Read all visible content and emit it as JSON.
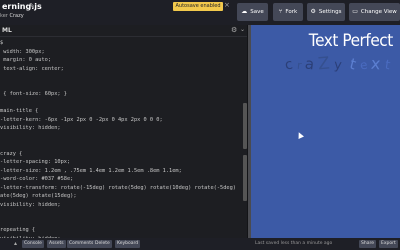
{
  "header": {
    "title": "erning.js",
    "author_prefix": "ker",
    "author_name": "Crazy",
    "autosave": "Autosave enabled",
    "save_label": "Save",
    "fork_label": "Fork",
    "settings_label": "Settings",
    "view_label": "Change View",
    "icons": [
      "pencil-icon",
      "close-icon",
      "cloud-icon",
      "fork-icon",
      "gear-icon",
      "layout-icon"
    ]
  },
  "editor": {
    "language": "ML",
    "lines": [
      "$",
      " width: 300px;",
      " margin: 0 auto;",
      " text-align: center;",
      "",
      "",
      " { font-size: 60px; }",
      "",
      "main-title {",
      "-letter-kern: -6px -1px 2px 0 -2px 0 4px 2px 0 0 0;",
      "visibility: hidden;",
      "",
      "",
      "crazy {",
      "-letter-spacing: 10px;",
      "-letter-size: 1.2em , .75em 1.4em 1.2em 1.5em .8em 1.1em;",
      "-word-color: #037 #58e;",
      "-letter-transform: rotate(-15deg) rotate(5deg) rotate(10deg) rotate(-5deg)",
      "ate(5deg) rotate(15deg);",
      "visibility: hidden;",
      "",
      "",
      "repeating {",
      "visibility: hidden;"
    ]
  },
  "preview": {
    "title": "Text Perfect",
    "crazy_letters": [
      "c",
      "r",
      "a",
      "Z",
      "y",
      " ",
      "t",
      "e",
      "x",
      "t"
    ]
  },
  "bottombar": {
    "console": "Console",
    "assets": "Assets",
    "comments": "Comments",
    "delete": "Delete",
    "keyboard": "Keyboard",
    "status": "Last saved less than a minute ago",
    "share": "Share",
    "export": "Export"
  },
  "colors": {
    "background": "#131417",
    "preview_bg": "#3c5aa6",
    "autosave_badge": "#f2c94c",
    "button_bg": "#444857"
  }
}
